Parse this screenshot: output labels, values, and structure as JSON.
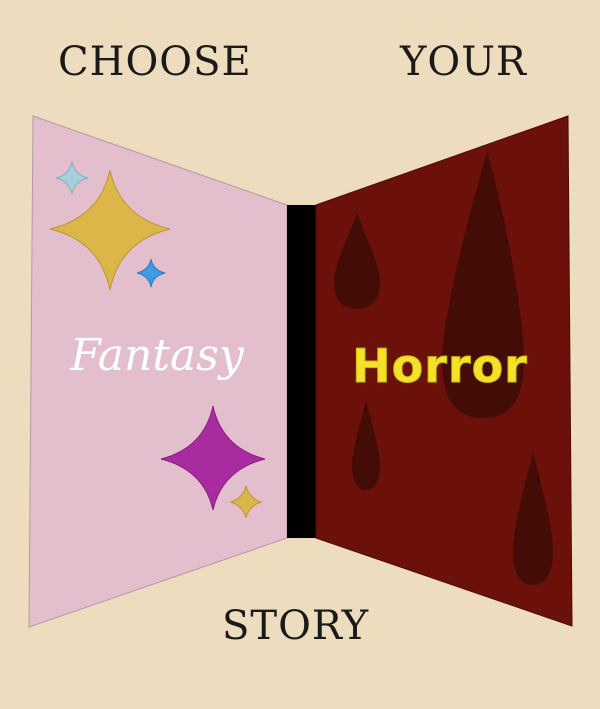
{
  "heading": {
    "word1": "CHOOSE",
    "word2": "YOUR",
    "word3": "STORY"
  },
  "choices": {
    "fantasy": {
      "label": "Fantasy",
      "panel_color": "#e3bfcd",
      "label_color": "#ffffff"
    },
    "horror": {
      "label": "Horror",
      "panel_color": "#6b1109",
      "label_color": "#f3e227",
      "drop_color": "#440c07"
    }
  },
  "decor": {
    "sparkle_colors": [
      "#ddb649",
      "#a6cfdb",
      "#3b9be5",
      "#a92ba0"
    ],
    "divider_color": "#000000",
    "background_color": "#eddcbd"
  }
}
